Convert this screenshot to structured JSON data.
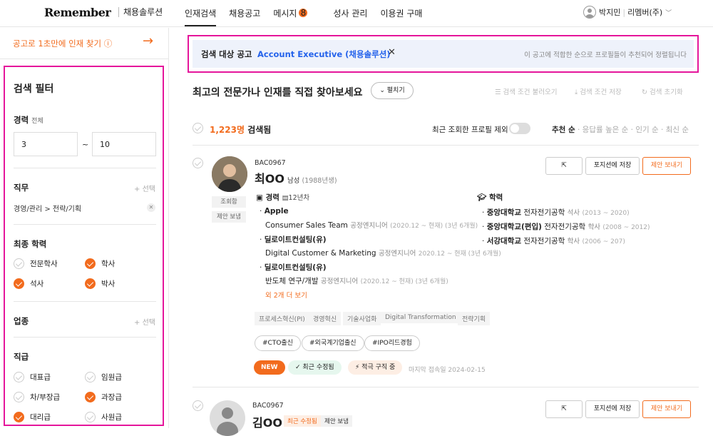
{
  "header": {
    "logo": "Remember",
    "logo_sub": "채용솔루션",
    "nav": [
      "인재검색",
      "채용공고",
      "메시지",
      "성사 관리",
      "이용권 구매"
    ],
    "message_badge": "8",
    "user_name": "박지민",
    "user_company": "리멤버(주)"
  },
  "sidebar": {
    "quick_link": "공고로 1초만에 인재 찾기 ⓘ",
    "filter_title": "검색 필터",
    "career_label": "경력",
    "career_sub": "전체",
    "career_min": "3",
    "career_max": "10",
    "career_tilde": "~",
    "job_label": "직무",
    "add_label": "+ 선택",
    "job_chip": "경영/관리 > 전략/기획",
    "edu_label": "최종 학력",
    "edu": [
      {
        "label": "전문학사",
        "checked": false
      },
      {
        "label": "학사",
        "checked": true
      },
      {
        "label": "석사",
        "checked": true
      },
      {
        "label": "박사",
        "checked": true
      }
    ],
    "industry_label": "업종",
    "rank_label": "직급",
    "ranks": [
      {
        "label": "대표급",
        "checked": false
      },
      {
        "label": "임원급",
        "checked": false
      },
      {
        "label": "차/부장급",
        "checked": false
      },
      {
        "label": "과장급",
        "checked": true
      },
      {
        "label": "대리급",
        "checked": true
      },
      {
        "label": "사원급",
        "checked": false
      }
    ]
  },
  "banner": {
    "label": "검색 대상 공고",
    "value": "Account Executive (채용솔루션)",
    "close": "✕",
    "note": "이 공고에 적합한 순으로 프로필들이 추천되어 정렬됩니다"
  },
  "main": {
    "title": "최고의 전문가나 인재를 직접 찾아보세요",
    "fold": "펼치기",
    "tools": [
      "☰ 검색 조건 불러오기",
      "⤓ 검색 조건 저장",
      "↻ 검색 초기화"
    ],
    "count": "1,223명",
    "count_suffix": "검색됨",
    "exclude": "최근 조회한 프로필 제외",
    "sort": [
      "추천 순",
      "응답률 높은 순",
      "인기 순",
      "최신 순"
    ]
  },
  "card1": {
    "code": "BAC0967",
    "name": "최OO",
    "gender": "남성",
    "birth": "(1988년생)",
    "tags": [
      "조회함",
      "제안 보냄"
    ],
    "buttons": {
      "save": "포지션에 저장",
      "offer": "제안 보내기"
    },
    "career_label": "경력",
    "career_years": "12년차",
    "careers": [
      {
        "company": "Apple",
        "role": "Consumer Sales Team",
        "pos": "공정엔지니어",
        "period": "(2020.12 ~ 현재) (3년 6개월)"
      },
      {
        "company": "딜로이트컨설팅(유)",
        "role": "Digital Customer & Marketing",
        "pos": "공정엔지니어",
        "period": "2020.12 ~ 현재 (3년 6개월)"
      },
      {
        "company": "딜로이트컨설팅(유)",
        "role": "반도체 연구/개발",
        "pos": "공정엔지니어",
        "period": "(2020.12 ~ 현재) (3년 6개월)"
      }
    ],
    "more": "외 2개 더 보기",
    "edu_label": "학력",
    "edus": [
      {
        "school": "중앙대학교",
        "major": "전자전기공학",
        "deg": "석사",
        "period": "(2013 ~ 2020)"
      },
      {
        "school": "중앙대학교(편입)",
        "major": "전자전기공학",
        "deg": "학사",
        "period": "(2008 ~ 2012)"
      },
      {
        "school": "서강대학교",
        "major": "전자전기공학",
        "deg": "학사",
        "period": "(2006 ~ 207)"
      }
    ],
    "keywords": [
      "프로세스혁신(PI)",
      "경영혁신",
      "기술사업화",
      "Digital Transformation",
      "전략기획"
    ],
    "hashtags": [
      "#CTO출신",
      "#외국계기업출신",
      "#IPO리드경험"
    ],
    "pills": [
      "NEW",
      "✓ 최근 수정됨",
      "⚡ 적극 구직 중"
    ],
    "last_seen": "마지막 접속일 2024-02-15"
  },
  "card2": {
    "code": "BAC0967",
    "name": "김OO",
    "mini": [
      "최근 수정됨",
      "제안 보냄"
    ],
    "buttons": {
      "save": "포지션에 저장",
      "offer": "제안 보내기"
    }
  },
  "colors": {
    "accent": "#f26b1d",
    "link": "#2563eb",
    "highlight": "#e5169b"
  }
}
